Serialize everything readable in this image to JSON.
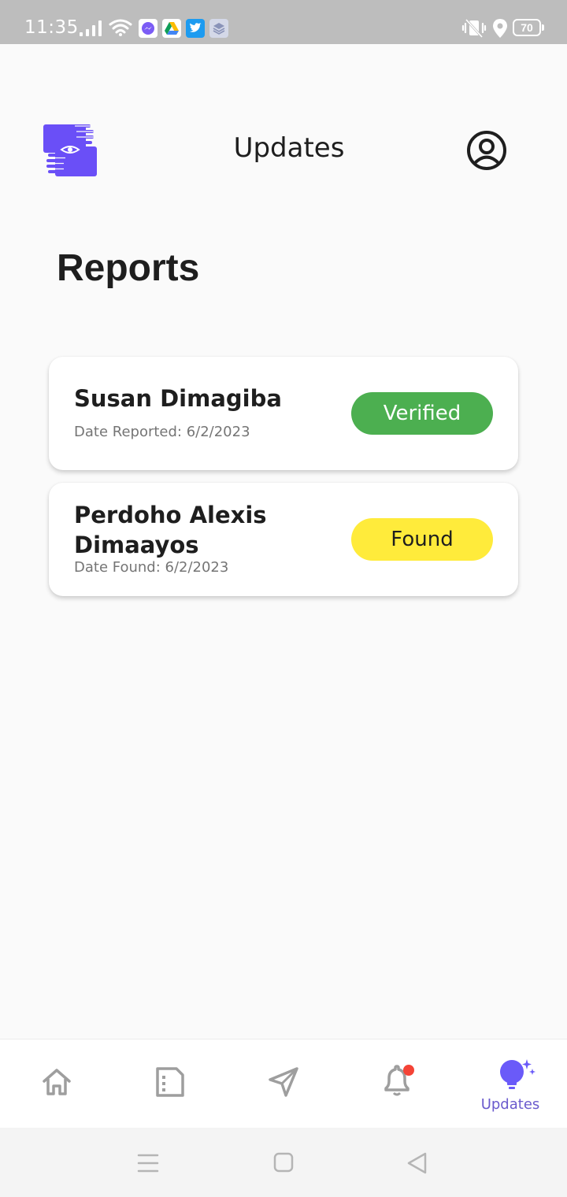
{
  "status_bar": {
    "time": "11:35",
    "battery": "70",
    "icons": [
      "signal-icon",
      "wifi-icon",
      "messenger-icon",
      "google-drive-icon",
      "twitter-icon",
      "layers-icon",
      "vibrate-icon",
      "location-icon",
      "battery-icon"
    ]
  },
  "header": {
    "title": "Updates",
    "logo_icon": "app-logo-hands-eye",
    "profile_icon": "user-circle-icon"
  },
  "section": {
    "title": "Reports"
  },
  "reports": [
    {
      "name": "Susan Dimagiba",
      "date": "Date Reported: 6/2/2023",
      "status": "Verified",
      "status_color": "#4caf50",
      "status_text_color": "#ffffff"
    },
    {
      "name_lines": [
        "Perdoho Alexis",
        "Dimaayos"
      ],
      "date": "Date Found: 6/2/2023",
      "status": "Found",
      "status_color": "#ffeb3b",
      "status_text_color": "#1e1e1e"
    }
  ],
  "bottom_nav": {
    "items": [
      {
        "icon": "home-icon",
        "label": ""
      },
      {
        "icon": "document-icon",
        "label": ""
      },
      {
        "icon": "send-icon",
        "label": ""
      },
      {
        "icon": "bell-icon",
        "label": "",
        "has_notification_dot": true
      },
      {
        "icon": "lightbulb-sparkle-icon",
        "label": "Updates",
        "active": true
      }
    ],
    "active_color": "#6a5af9",
    "inactive_color": "#9e9e9e",
    "notification_color": "#f44336"
  },
  "system_nav": {
    "icons": [
      "menu-icon",
      "home-square-icon",
      "back-triangle-icon"
    ]
  }
}
